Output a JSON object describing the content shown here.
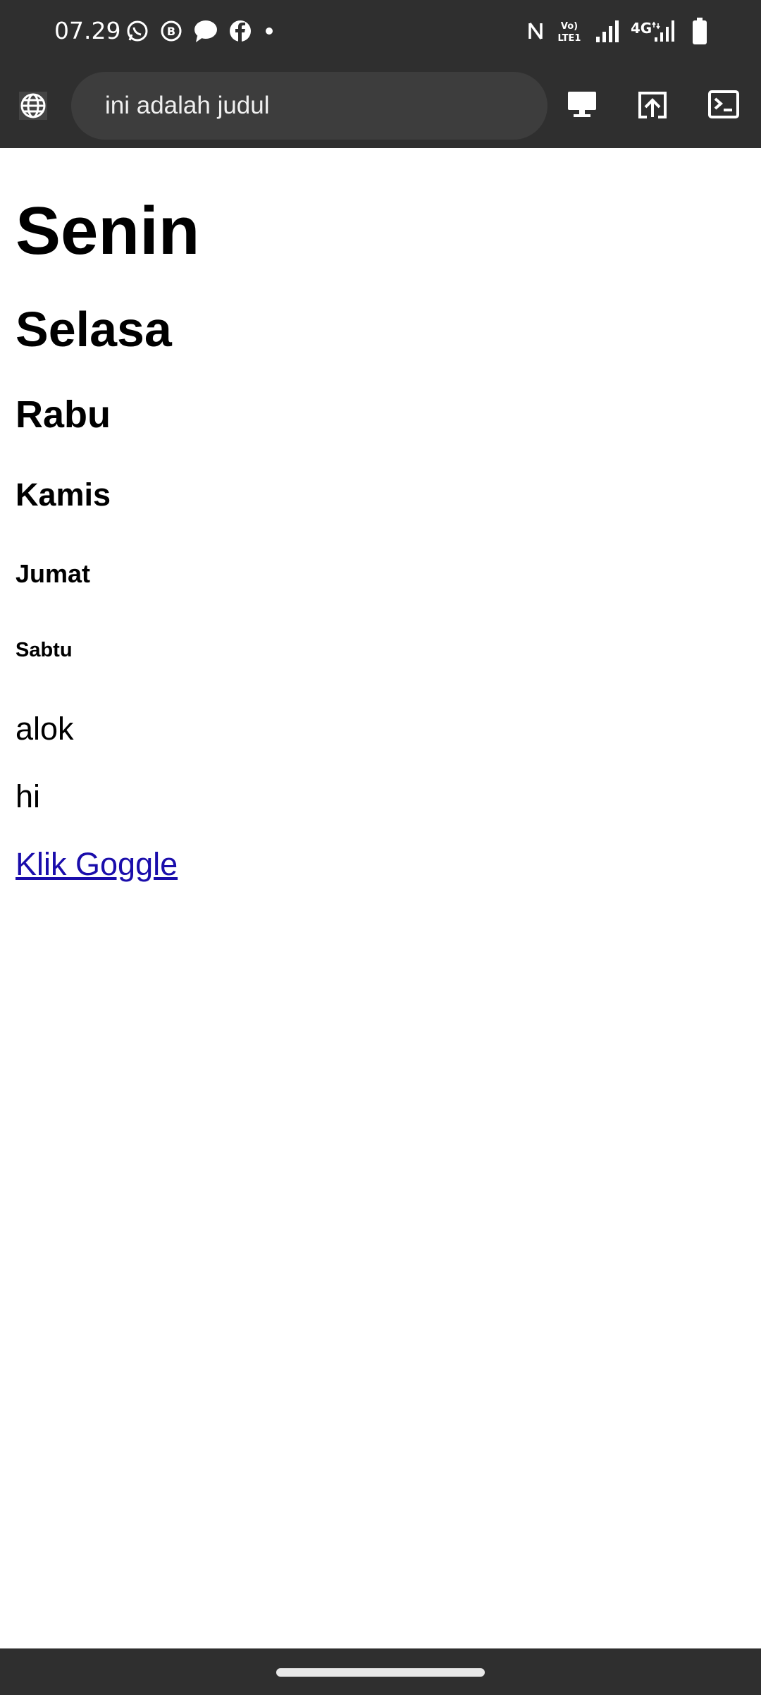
{
  "status_bar": {
    "time": "07.29",
    "network_label": "4G",
    "volte_label": "Vo) LTE1",
    "left_icons": [
      "whatsapp-icon",
      "whatsapp-business-icon",
      "messages-icon",
      "facebook-icon",
      "dot-icon"
    ],
    "right_icons": [
      "nfc-icon",
      "volte-icon",
      "signal-icon",
      "4g-signal-icon",
      "battery-icon"
    ]
  },
  "browser": {
    "url_text": "ini adalah judul",
    "buttons": [
      "desktop-view-icon",
      "share-upload-icon",
      "terminal-icon"
    ]
  },
  "page": {
    "h1": "Senin",
    "h2": "Selasa",
    "h3": "Rabu",
    "h4": "Kamis",
    "h5": "Jumat",
    "h6": "Sabtu",
    "paragraphs": [
      "alok",
      "hi"
    ],
    "link_text": "Klik Goggle"
  },
  "colors": {
    "system_bar": "#2f2f2f",
    "url_box": "#3d3d3d",
    "link": "#1a0dab"
  }
}
